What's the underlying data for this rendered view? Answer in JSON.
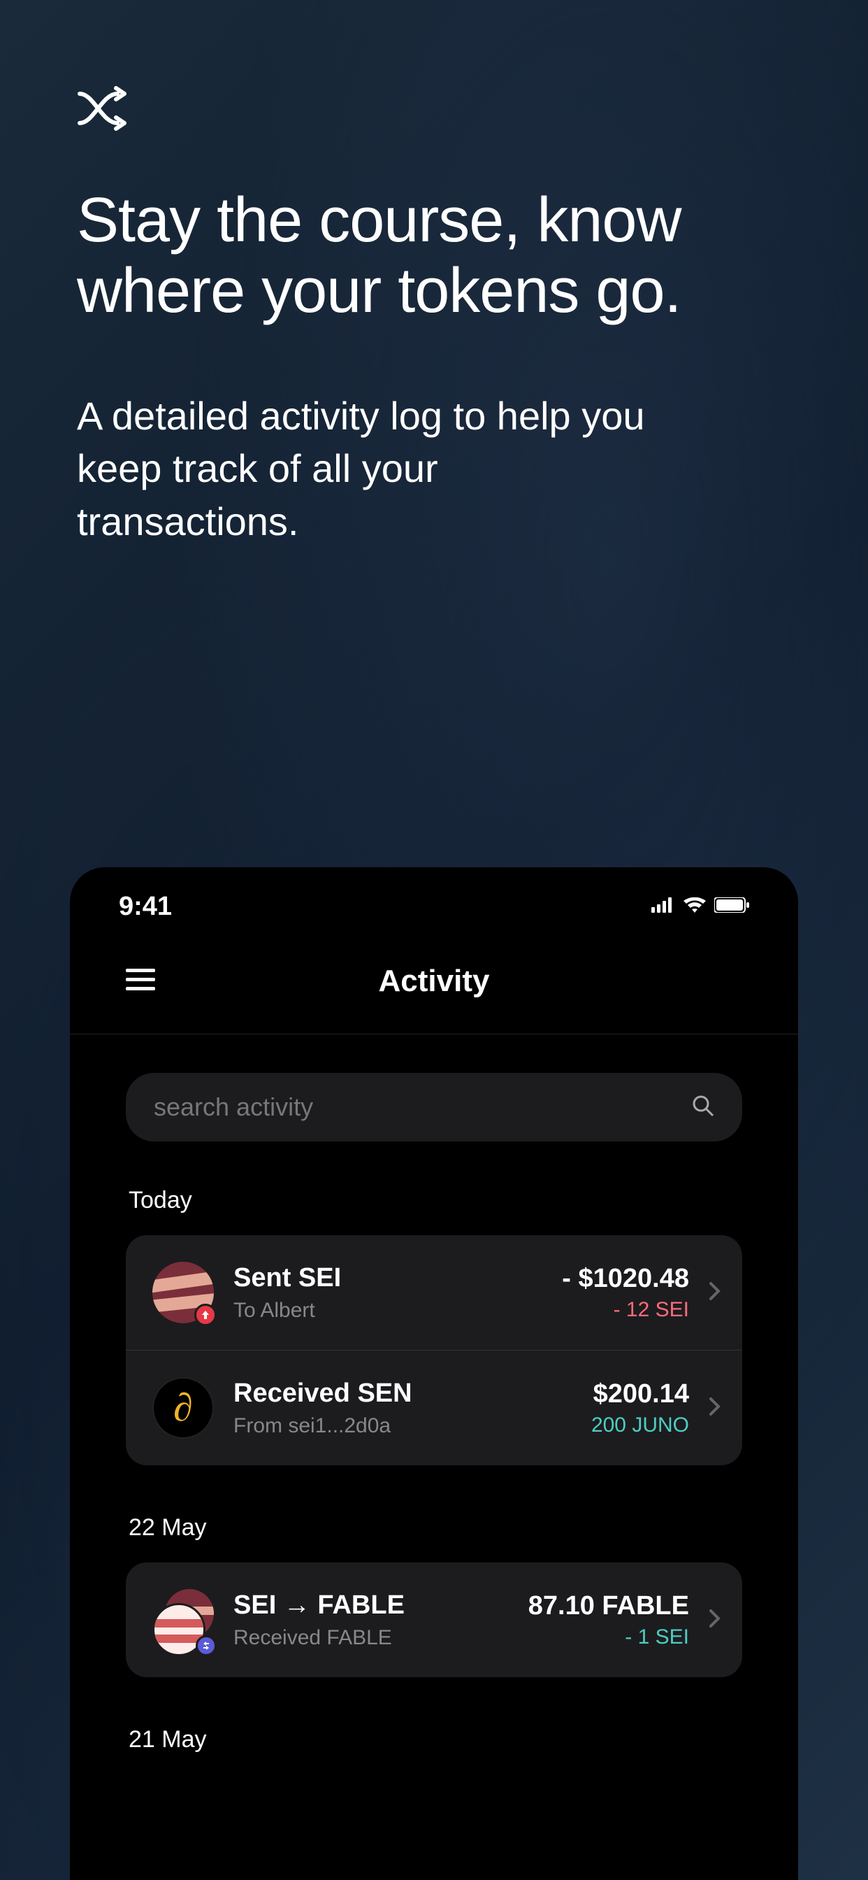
{
  "marketing": {
    "headline": "Stay the course, know where your tokens go.",
    "subhead": "A detailed activity log to help you keep track of all your transactions."
  },
  "statusbar": {
    "time": "9:41"
  },
  "app": {
    "title": "Activity",
    "search_placeholder": "search activity"
  },
  "sections": [
    {
      "label": "Today",
      "rows": [
        {
          "icon": "sei-sent",
          "title": "Sent SEI",
          "sub": "To Albert",
          "amt_primary": "- $1020.48",
          "amt_secondary": "- 12 SEI",
          "amt_class": "amt-red"
        },
        {
          "icon": "sen",
          "title": "Received SEN",
          "sub": "From sei1...2d0a",
          "amt_primary": "$200.14",
          "amt_secondary": "200 JUNO",
          "amt_class": "amt-green"
        }
      ]
    },
    {
      "label": "22 May",
      "rows": [
        {
          "icon": "swap",
          "title": "SEI → FABLE",
          "sub": "Received FABLE",
          "amt_primary": "87.10 FABLE",
          "amt_secondary": "- 1 SEI",
          "amt_class": "amt-green"
        }
      ]
    },
    {
      "label": "21 May",
      "rows": []
    }
  ]
}
